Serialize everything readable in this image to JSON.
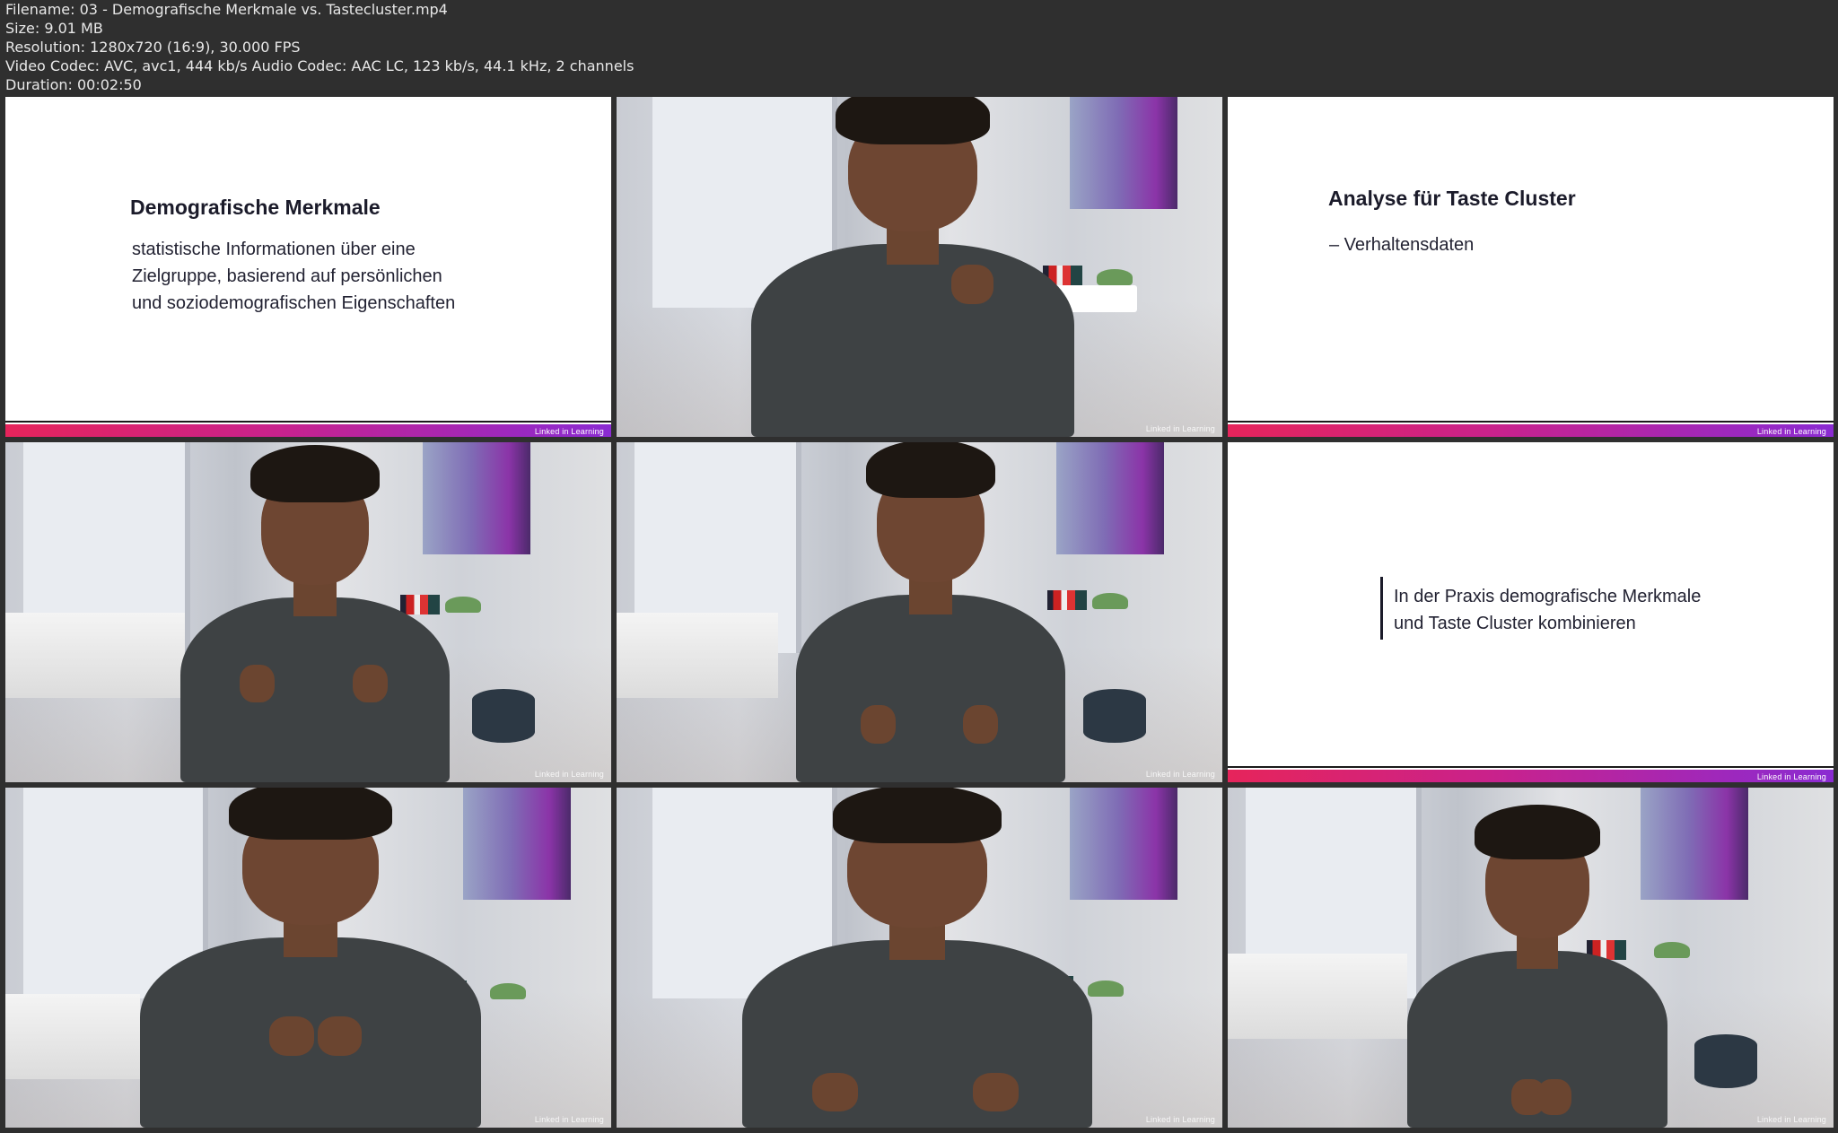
{
  "header": {
    "filename": "Filename: 03 - Demografische Merkmale vs. Tastecluster.mp4",
    "size": "Size: 9.01 MB",
    "resolution": "Resolution: 1280x720 (16:9), 30.000 FPS",
    "codec": "Video Codec: AVC, avc1, 444 kb/s Audio Codec: AAC LC, 123 kb/s, 44.1 kHz, 2 channels",
    "duration": "Duration: 00:02:50"
  },
  "brand": "Linked in Learning",
  "slides": {
    "s1": {
      "title": "Demografische Merkmale",
      "line1": "statistische Informationen über eine",
      "line2": "Zielgruppe, basierend auf persönlichen",
      "line3": "und soziodemografischen Eigenschaften"
    },
    "s2": {
      "title": "Analyse für Taste Cluster",
      "bullet": "–  Verhaltensdaten"
    },
    "s3": {
      "line1": "In der Praxis demografische Merkmale",
      "line2": "und Taste Cluster kombinieren"
    }
  },
  "colors": {
    "background": "#2f2f2f",
    "bar_start": "#e6245b",
    "bar_end": "#8a2bd2"
  }
}
